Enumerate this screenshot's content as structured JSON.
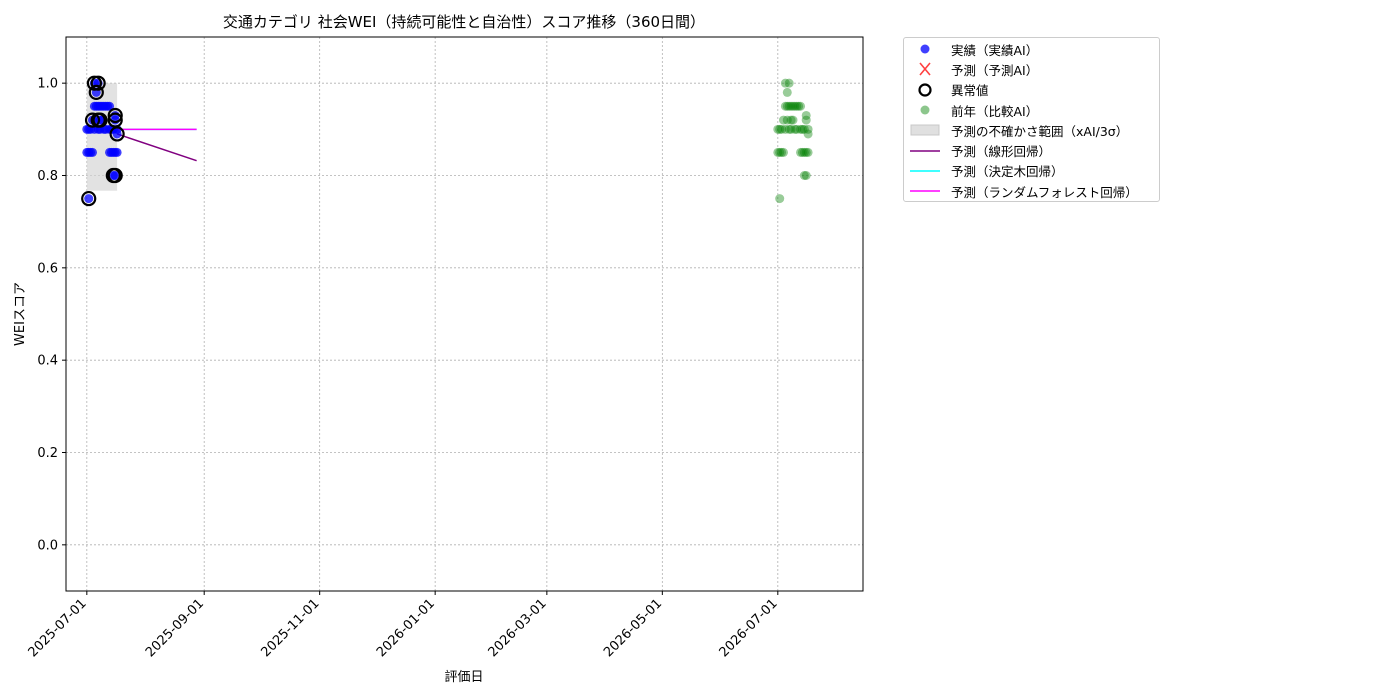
{
  "chart_data": {
    "type": "scatter",
    "title": "交通カテゴリ 社会WEI（持続可能性と自治性）スコア推移（360日間）",
    "xlabel": "評価日",
    "ylabel": "WEIスコア",
    "xlim": [
      "2025-06-20",
      "2026-08-15"
    ],
    "ylim": [
      -0.1,
      1.1
    ],
    "x_ticks": [
      "2025-07-01",
      "2025-09-01",
      "2025-11-01",
      "2026-01-01",
      "2026-03-01",
      "2026-05-01",
      "2026-07-01"
    ],
    "y_ticks": [
      "0.0",
      "0.2",
      "0.4",
      "0.6",
      "0.8",
      "1.0"
    ],
    "grid": true,
    "legend_position": "outside-right",
    "series": [
      {
        "name": "実績（実績AI）",
        "kind": "scatter",
        "color": "#0000ff",
        "points": [
          [
            "2025-07-01",
            0.85
          ],
          [
            "2025-07-01",
            0.9
          ],
          [
            "2025-07-02",
            0.75
          ],
          [
            "2025-07-02",
            0.85
          ],
          [
            "2025-07-02",
            0.9
          ],
          [
            "2025-07-03",
            0.85
          ],
          [
            "2025-07-03",
            0.9
          ],
          [
            "2025-07-04",
            0.85
          ],
          [
            "2025-07-04",
            0.92
          ],
          [
            "2025-07-05",
            0.9
          ],
          [
            "2025-07-05",
            0.95
          ],
          [
            "2025-07-05",
            1.0
          ],
          [
            "2025-07-06",
            0.92
          ],
          [
            "2025-07-06",
            0.95
          ],
          [
            "2025-07-06",
            0.98
          ],
          [
            "2025-07-07",
            0.9
          ],
          [
            "2025-07-07",
            0.95
          ],
          [
            "2025-07-07",
            1.0
          ],
          [
            "2025-07-08",
            0.9
          ],
          [
            "2025-07-08",
            0.92
          ],
          [
            "2025-07-08",
            0.95
          ],
          [
            "2025-07-09",
            0.92
          ],
          [
            "2025-07-09",
            0.95
          ],
          [
            "2025-07-10",
            0.9
          ],
          [
            "2025-07-10",
            0.95
          ],
          [
            "2025-07-11",
            0.9
          ],
          [
            "2025-07-11",
            0.95
          ],
          [
            "2025-07-12",
            0.95
          ],
          [
            "2025-07-13",
            0.85
          ],
          [
            "2025-07-13",
            0.9
          ],
          [
            "2025-07-13",
            0.95
          ],
          [
            "2025-07-14",
            0.85
          ],
          [
            "2025-07-14",
            0.9
          ],
          [
            "2025-07-15",
            0.8
          ],
          [
            "2025-07-15",
            0.85
          ],
          [
            "2025-07-15",
            0.9
          ],
          [
            "2025-07-16",
            0.8
          ],
          [
            "2025-07-16",
            0.85
          ],
          [
            "2025-07-16",
            0.92
          ],
          [
            "2025-07-16",
            0.93
          ],
          [
            "2025-07-17",
            0.85
          ],
          [
            "2025-07-17",
            0.89
          ],
          [
            "2025-07-17",
            0.9
          ]
        ]
      },
      {
        "name": "予測（予測AI）",
        "kind": "x-marker",
        "color": "#ff0000",
        "points": []
      },
      {
        "name": "異常値",
        "kind": "ring",
        "color": "#000000",
        "points": [
          [
            "2025-07-02",
            0.75
          ],
          [
            "2025-07-04",
            0.92
          ],
          [
            "2025-07-05",
            1.0
          ],
          [
            "2025-07-06",
            0.98
          ],
          [
            "2025-07-07",
            1.0
          ],
          [
            "2025-07-07",
            0.92
          ],
          [
            "2025-07-08",
            0.92
          ],
          [
            "2025-07-15",
            0.8
          ],
          [
            "2025-07-16",
            0.8
          ],
          [
            "2025-07-16",
            0.93
          ],
          [
            "2025-07-16",
            0.92
          ],
          [
            "2025-07-17",
            0.89
          ]
        ]
      },
      {
        "name": "前年（比較AI）",
        "kind": "scatter",
        "color": "#008000",
        "points": [
          [
            "2026-07-01",
            0.85
          ],
          [
            "2026-07-01",
            0.9
          ],
          [
            "2026-07-02",
            0.75
          ],
          [
            "2026-07-02",
            0.85
          ],
          [
            "2026-07-02",
            0.9
          ],
          [
            "2026-07-03",
            0.85
          ],
          [
            "2026-07-03",
            0.9
          ],
          [
            "2026-07-04",
            0.85
          ],
          [
            "2026-07-04",
            0.92
          ],
          [
            "2026-07-05",
            0.9
          ],
          [
            "2026-07-05",
            0.95
          ],
          [
            "2026-07-05",
            1.0
          ],
          [
            "2026-07-06",
            0.92
          ],
          [
            "2026-07-06",
            0.95
          ],
          [
            "2026-07-06",
            0.98
          ],
          [
            "2026-07-07",
            0.9
          ],
          [
            "2026-07-07",
            0.95
          ],
          [
            "2026-07-07",
            1.0
          ],
          [
            "2026-07-08",
            0.9
          ],
          [
            "2026-07-08",
            0.92
          ],
          [
            "2026-07-08",
            0.95
          ],
          [
            "2026-07-09",
            0.92
          ],
          [
            "2026-07-09",
            0.95
          ],
          [
            "2026-07-10",
            0.9
          ],
          [
            "2026-07-10",
            0.95
          ],
          [
            "2026-07-11",
            0.9
          ],
          [
            "2026-07-11",
            0.95
          ],
          [
            "2026-07-12",
            0.95
          ],
          [
            "2026-07-13",
            0.85
          ],
          [
            "2026-07-13",
            0.9
          ],
          [
            "2026-07-13",
            0.95
          ],
          [
            "2026-07-14",
            0.85
          ],
          [
            "2026-07-14",
            0.9
          ],
          [
            "2026-07-15",
            0.8
          ],
          [
            "2026-07-15",
            0.85
          ],
          [
            "2026-07-15",
            0.9
          ],
          [
            "2026-07-16",
            0.8
          ],
          [
            "2026-07-16",
            0.85
          ],
          [
            "2026-07-16",
            0.92
          ],
          [
            "2026-07-16",
            0.93
          ],
          [
            "2026-07-17",
            0.85
          ],
          [
            "2026-07-17",
            0.89
          ],
          [
            "2026-07-17",
            0.9
          ]
        ]
      },
      {
        "name": "予測の不確かさ範囲（xAI/3σ）",
        "kind": "band",
        "color": "#d3d3d3",
        "x": [
          "2025-07-01",
          "2025-07-17"
        ],
        "y": [
          0.767,
          1.0
        ]
      },
      {
        "name": "予測（線形回帰）",
        "kind": "line",
        "color": "#800080",
        "points": [
          [
            "2025-07-17",
            0.89
          ],
          [
            "2025-08-28",
            0.832
          ]
        ]
      },
      {
        "name": "予測（決定木回帰）",
        "kind": "line",
        "color": "#00ffff",
        "points": [
          [
            "2025-07-17",
            0.9
          ],
          [
            "2025-08-28",
            0.9
          ]
        ]
      },
      {
        "name": "予測（ランダムフォレスト回帰）",
        "kind": "line",
        "color": "#ff00ff",
        "points": [
          [
            "2025-07-17",
            0.9
          ],
          [
            "2025-08-28",
            0.9
          ]
        ]
      }
    ]
  }
}
